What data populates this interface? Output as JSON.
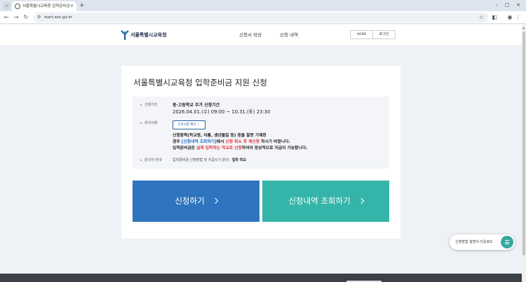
{
  "browser": {
    "tab_title": "서울특별시교육청 입학준비금",
    "url": "start.sen.go.kr",
    "icons": {
      "tab_menu": "chevron-down-icon",
      "favicon": "globe-icon",
      "close": "close-icon",
      "new_tab": "plus-icon",
      "back": "arrow-left-icon",
      "forward": "arrow-right-icon",
      "reload": "reload-icon",
      "site_info": "tune-icon",
      "bookmark": "star-icon",
      "extensions": "puzzle-icon",
      "profile": "profile-icon",
      "menu": "kebab-icon"
    },
    "glyphs": {
      "tab_menu": "⌄",
      "close": "×",
      "new_tab": "+",
      "minimize": "–",
      "maximize": "□",
      "win_close": "×",
      "back": "←",
      "forward": "→",
      "reload": "↻",
      "site_info": "⚙",
      "bookmark": "☆",
      "extensions": "◧",
      "profile": "◉",
      "menu": "⋮"
    }
  },
  "header": {
    "logo_text": "서울특별시교육청",
    "nav": [
      {
        "label": "신청서 작성"
      },
      {
        "label": "신청 내역"
      }
    ],
    "util": {
      "home_label": "HOME",
      "login_label": "로그인"
    }
  },
  "card": {
    "title": "서울특별시교육청 입학준비금 지원 신청",
    "period": {
      "label": "신청기간",
      "line1": "중·고등학교 추가 신청기간",
      "line2": "2026.04.01.(수) 09:00 ~ 10.31.(토) 23:30"
    },
    "notice": {
      "label": "유의사항",
      "button": "유의사항 확인",
      "button_glyph": "〉",
      "line1": "신청항목(학교명, 이름, 생년월일 등) 등을 잘못 기재한",
      "line2_a": "경우 ",
      "line2_b": "[신청내역 조회하기]",
      "line2_c": "에서 ",
      "line2_d": "신청 취소 후 재신청",
      "line2_e": " 하시기 바랍니다.",
      "line3_a": "입학준비금은 ",
      "line3_b": "실제 입학하는 학교로 신청",
      "line3_c": "하여야 정상적으로 지급이 가능합니다."
    },
    "contact": {
      "label": "문의처 안내",
      "text": "입학준비금 신청방법 및 지급시기 문의 : ",
      "bold": "입학 학교"
    },
    "buttons": {
      "apply": "신청하기",
      "history": "신청내역 조회하기"
    }
  },
  "floating": {
    "download_label": "신청방법 설명서 다운로드"
  },
  "colors": {
    "apply_button": "#2f74bf",
    "history_button": "#35b5a9",
    "highlight_red": "#e5383b",
    "highlight_blue": "#2a6fc7",
    "footer": "#3c4047"
  }
}
